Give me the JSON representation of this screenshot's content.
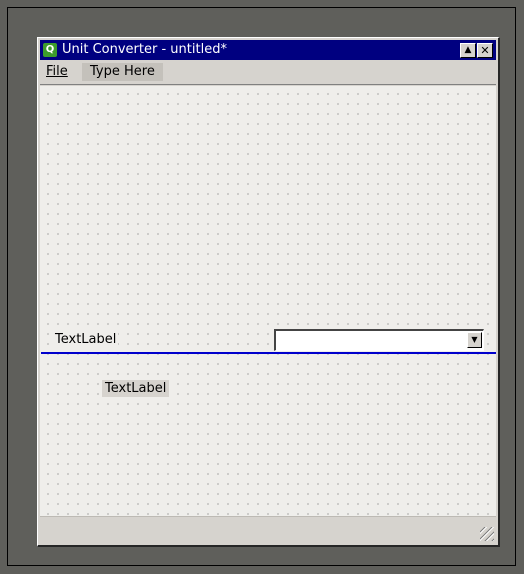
{
  "window": {
    "title": "Unit Converter - untitled*",
    "icon": "qt-designer-app-icon",
    "max_glyph": "▲",
    "close_glyph": "✕"
  },
  "menubar": {
    "file": "File",
    "type_here": "Type Here"
  },
  "form": {
    "label_1": "TextLabel",
    "label_2": "TextLabel",
    "combobox_value": "",
    "combobox_arrow": "▼"
  },
  "colors": {
    "titlebar": "#000080",
    "selection_line": "#0000cc",
    "window_bg": "#d6d3ce",
    "desktop": "#5f5f5b"
  }
}
